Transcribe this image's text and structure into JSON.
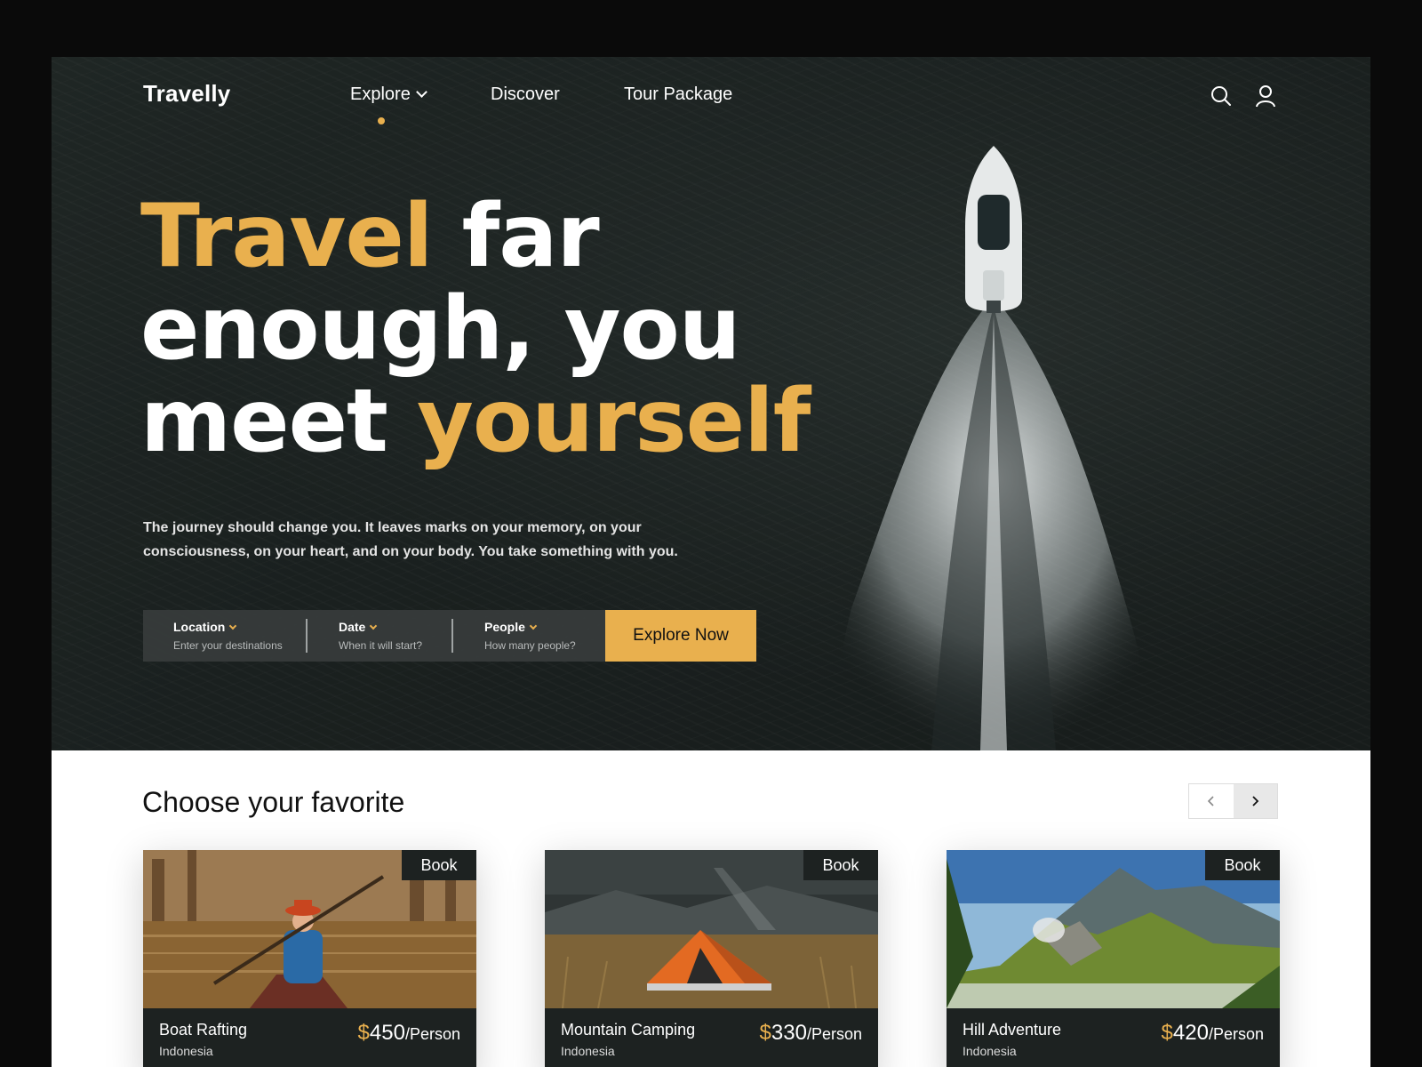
{
  "nav": {
    "logo": "Travelly",
    "items": [
      {
        "label": "Explore"
      },
      {
        "label": "Discover"
      },
      {
        "label": "Tour Package"
      }
    ],
    "icons": [
      "search-icon",
      "user-icon"
    ]
  },
  "hero": {
    "headline": {
      "line1_gold": "Travel",
      "line1_white": " far",
      "line2": "enough, you",
      "line3_white": "meet ",
      "line3_gold": "yourself"
    },
    "subtext": "The journey should change you. It leaves marks on your memory, on your consciousness, on your heart, and on your body. You take something with you."
  },
  "search": {
    "location": {
      "label": "Location",
      "hint": "Enter your destinations"
    },
    "date": {
      "label": "Date",
      "hint": "When it will start?"
    },
    "people": {
      "label": "People",
      "hint": "How many people?"
    },
    "button": "Explore Now"
  },
  "section": {
    "title": "Choose your favorite"
  },
  "cards": [
    {
      "name": "Boat Rafting",
      "country": "Indonesia",
      "currency": "$",
      "price": "450",
      "unit": "/Person",
      "book": "Book"
    },
    {
      "name": "Mountain Camping",
      "country": "Indonesia",
      "currency": "$",
      "price": "330",
      "unit": "/Person",
      "book": "Book"
    },
    {
      "name": "Hill Adventure",
      "country": "Indonesia",
      "currency": "$",
      "price": "420",
      "unit": "/Person",
      "book": "Book"
    }
  ],
  "colors": {
    "accent": "#e9b04e",
    "dark": "#1d2221",
    "hero_bg": "#1a201f"
  }
}
